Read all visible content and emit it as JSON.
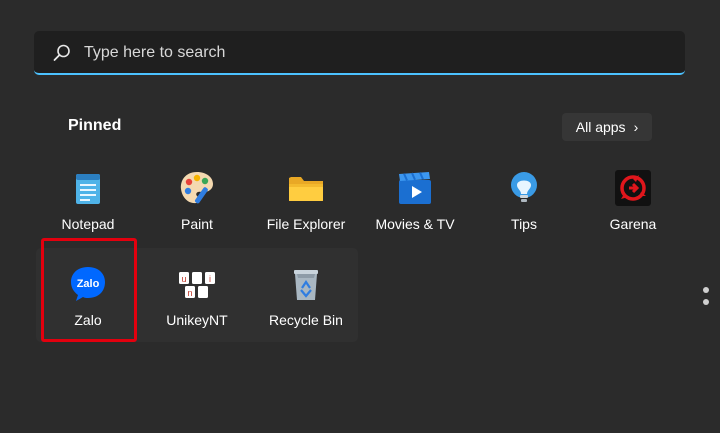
{
  "search": {
    "placeholder": "Type here to search"
  },
  "pinned": {
    "title": "Pinned",
    "all_apps_label": "All apps",
    "apps": [
      {
        "label": "Notepad",
        "icon": "notepad-icon"
      },
      {
        "label": "Paint",
        "icon": "paint-icon"
      },
      {
        "label": "File Explorer",
        "icon": "file-explorer-icon"
      },
      {
        "label": "Movies & TV",
        "icon": "movies-tv-icon"
      },
      {
        "label": "Tips",
        "icon": "tips-icon"
      },
      {
        "label": "Garena",
        "icon": "garena-icon"
      },
      {
        "label": "Zalo",
        "icon": "zalo-icon",
        "icon_text": "Zalo"
      },
      {
        "label": "UnikeyNT",
        "icon": "unikey-icon",
        "icon_text": [
          "u",
          "n",
          "i"
        ]
      },
      {
        "label": "Recycle Bin",
        "icon": "recycle-bin-icon"
      }
    ]
  },
  "colors": {
    "background": "#2b2b2b",
    "search_accent": "#4cc2ff",
    "highlight_border": "#e3000e"
  }
}
